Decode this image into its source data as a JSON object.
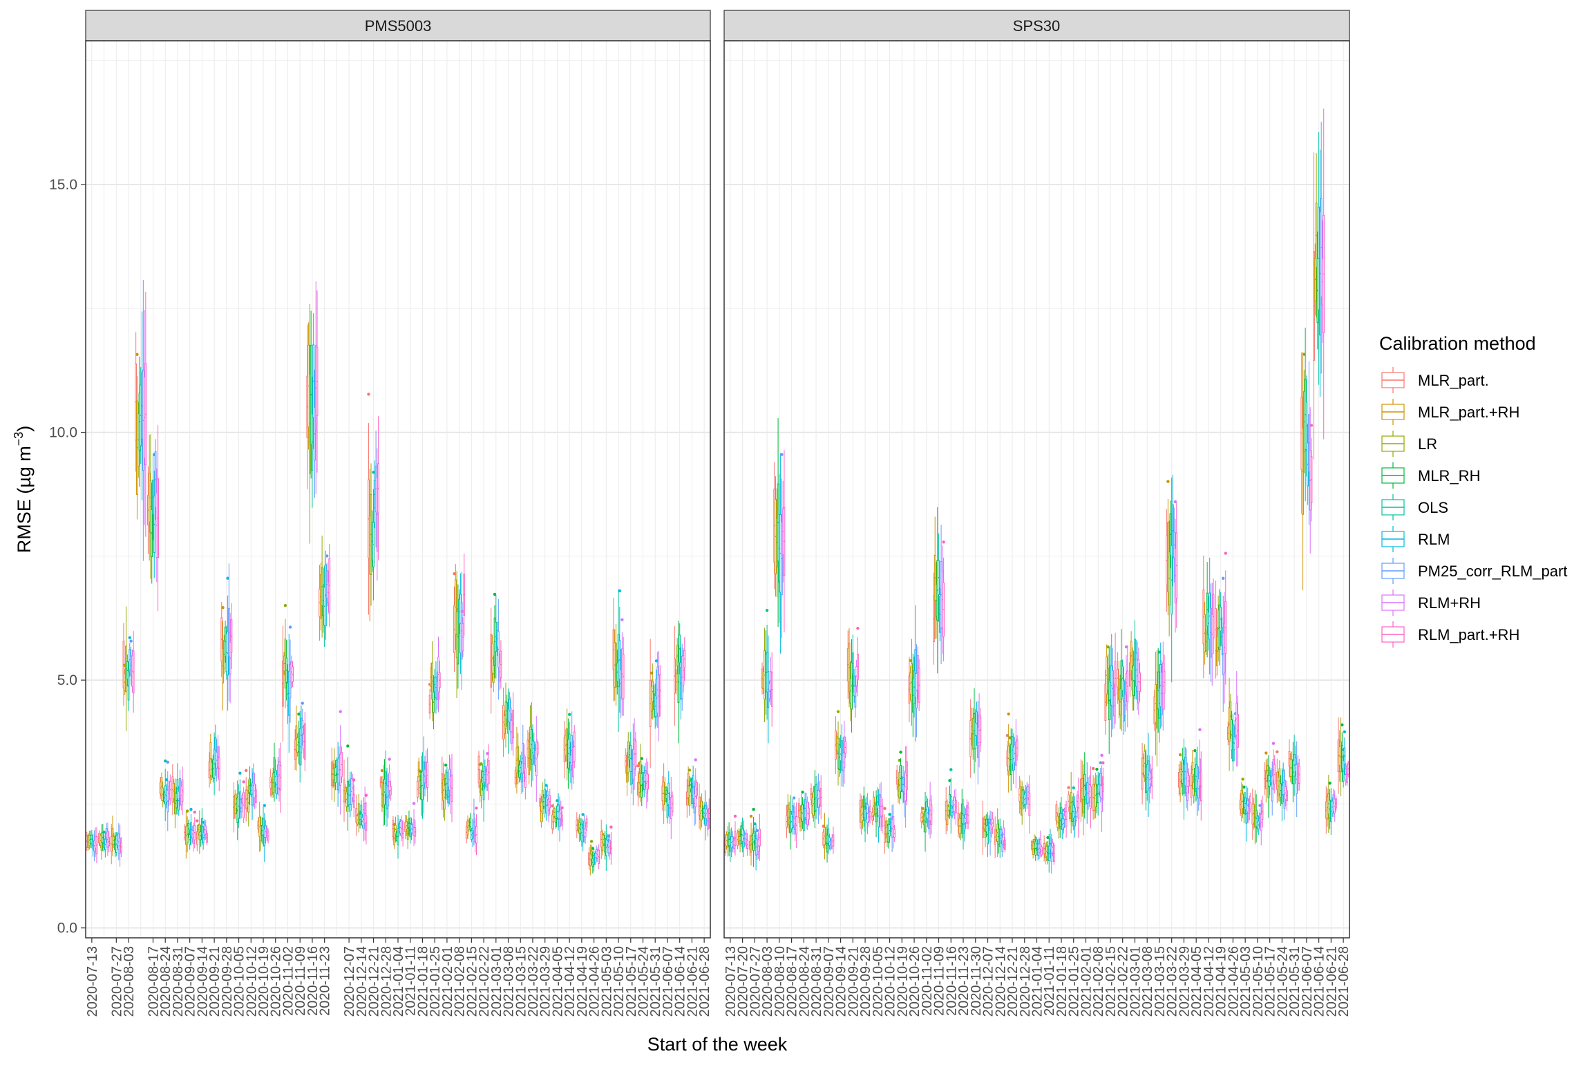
{
  "chart_data": {
    "type": "boxplot",
    "facets": [
      "PMS5003",
      "SPS30"
    ],
    "xlabel": "Start of the week",
    "ylabel": "RMSE (µg m",
    "ylabel_superscript": "−3",
    "ylabel_close": ")",
    "ylim": [
      -0.2,
      17.9
    ],
    "yticks": [
      0.0,
      5.0,
      10.0,
      15.0
    ],
    "ytick_labels": [
      "0.0",
      "5.0",
      "10.0",
      "15.0"
    ],
    "weeks": [
      "2020-07-13",
      "2020-07-20",
      "2020-07-27",
      "2020-08-03",
      "2020-08-10",
      "2020-08-17",
      "2020-08-24",
      "2020-08-31",
      "2020-09-07",
      "2020-09-14",
      "2020-09-21",
      "2020-09-28",
      "2020-10-05",
      "2020-10-12",
      "2020-10-19",
      "2020-10-26",
      "2020-11-02",
      "2020-11-09",
      "2020-11-16",
      "2020-11-23",
      "2020-11-30",
      "2020-12-07",
      "2020-12-14",
      "2020-12-21",
      "2020-12-28",
      "2021-01-04",
      "2021-01-11",
      "2021-01-18",
      "2021-01-25",
      "2021-02-01",
      "2021-02-08",
      "2021-02-15",
      "2021-02-22",
      "2021-03-01",
      "2021-03-08",
      "2021-03-15",
      "2021-03-22",
      "2021-03-29",
      "2021-04-05",
      "2021-04-12",
      "2021-04-19",
      "2021-04-26",
      "2021-05-03",
      "2021-05-10",
      "2021-05-17",
      "2021-05-24",
      "2021-05-31",
      "2021-06-07",
      "2021-06-14",
      "2021-06-21",
      "2021-06-28"
    ],
    "xtick_labels": {
      "PMS5003": [
        "2020-07-13",
        "2020-07-27",
        "2020-08-03",
        "2020-08-17",
        "2020-08-24",
        "2020-08-31",
        "2020-09-07",
        "2020-09-14",
        "2020-09-21",
        "2020-09-28",
        "2020-10-05",
        "2020-10-12",
        "2020-10-19",
        "2020-10-26",
        "2020-11-02",
        "2020-11-09",
        "2020-11-16",
        "2020-11-23",
        "2020-12-07",
        "2020-12-14",
        "2020-12-21",
        "2020-12-28",
        "2021-01-04",
        "2021-01-11",
        "2021-01-18",
        "2021-01-25",
        "2021-02-01",
        "2021-02-08",
        "2021-02-15",
        "2021-02-22",
        "2021-03-01",
        "2021-03-08",
        "2021-03-15",
        "2021-03-22",
        "2021-03-29",
        "2021-04-05",
        "2021-04-12",
        "2021-04-19",
        "2021-04-26",
        "2021-05-03",
        "2021-05-10",
        "2021-05-17",
        "2021-05-24",
        "2021-05-31",
        "2021-06-07",
        "2021-06-14",
        "2021-06-21",
        "2021-06-28"
      ],
      "SPS30": [
        "2020-07-13",
        "2020-07-20",
        "2020-07-27",
        "2020-08-03",
        "2020-08-10",
        "2020-08-17",
        "2020-08-24",
        "2020-08-31",
        "2020-09-07",
        "2020-09-14",
        "2020-09-21",
        "2020-09-28",
        "2020-10-05",
        "2020-10-12",
        "2020-10-19",
        "2020-10-26",
        "2020-11-02",
        "2020-11-09",
        "2020-11-16",
        "2020-11-23",
        "2020-11-30",
        "2020-12-07",
        "2020-12-14",
        "2020-12-21",
        "2020-12-28",
        "2021-01-04",
        "2021-01-11",
        "2021-01-18",
        "2021-01-25",
        "2021-02-01",
        "2021-02-08",
        "2021-02-15",
        "2021-02-22",
        "2021-03-01",
        "2021-03-08",
        "2021-03-15",
        "2021-03-22",
        "2021-03-29",
        "2021-04-05",
        "2021-04-12",
        "2021-04-19",
        "2021-04-26",
        "2021-05-03",
        "2021-05-10",
        "2021-05-17",
        "2021-05-24",
        "2021-05-31",
        "2021-06-07",
        "2021-06-14",
        "2021-06-21",
        "2021-06-28"
      ]
    },
    "legend": {
      "title": "Calibration method",
      "position": "right",
      "entries": [
        {
          "name": "MLR_part.",
          "color": "#F8766D"
        },
        {
          "name": "MLR_part.+RH",
          "color": "#D39200"
        },
        {
          "name": "LR",
          "color": "#93AA00"
        },
        {
          "name": "MLR_RH",
          "color": "#00BA38"
        },
        {
          "name": "OLS",
          "color": "#00C19F"
        },
        {
          "name": "RLM",
          "color": "#00B9E3"
        },
        {
          "name": "PM25_corr_RLM_part",
          "color": "#619CFF"
        },
        {
          "name": "RLM+RH",
          "color": "#DB72FB"
        },
        {
          "name": "RLM_part.+RH",
          "color": "#FF61C3"
        }
      ]
    },
    "weekly_rmse_median_approx": {
      "PMS5003": [
        1.75,
        1.8,
        1.75,
        5.2,
        10.3,
        8.5,
        2.7,
        2.65,
        1.9,
        1.95,
        3.4,
        5.6,
        2.55,
        2.7,
        1.95,
        3.0,
        5.0,
        3.8,
        10.5,
        6.5,
        3.2,
        2.7,
        2.2,
        8.3,
        2.8,
        1.9,
        2.0,
        3.0,
        4.8,
        2.8,
        6.3,
        2.0,
        3.0,
        5.5,
        4.2,
        3.2,
        3.6,
        2.5,
        2.2,
        3.5,
        2.0,
        1.4,
        1.7,
        5.3,
        3.3,
        3.0,
        4.8,
        2.6,
        5.3,
        2.7,
        2.3,
        3.1,
        6.7,
        5.2,
        8.3,
        4.6,
        8.5,
        10.8,
        4.4,
        6.8,
        4.8,
        8.3,
        3.1,
        6.7,
        6.2,
        8.2,
        5.1,
        4.7,
        2.3,
        2.9,
        3.0,
        3.3,
        3.9,
        4.5,
        9.0,
        12.4,
        11.9,
        2.6,
        3.4,
        3.6,
        4.5,
        3.4
      ],
      "SPS30": [
        1.7,
        1.8,
        1.75,
        5.0,
        8.0,
        2.2,
        2.3,
        2.6,
        1.8,
        3.5,
        5.0,
        2.3,
        2.4,
        2.0,
        2.9,
        5.0,
        2.3,
        6.7,
        2.4,
        2.2,
        4.0,
        2.0,
        1.8,
        3.5,
        2.6,
        1.6,
        1.6,
        2.2,
        2.4,
        2.7,
        2.8,
        4.8,
        4.8,
        5.3,
        3.2,
        4.7,
        7.5,
        3.0,
        3.0,
        6.2,
        5.9,
        4.0,
        2.4,
        2.2,
        3.0,
        2.8,
        3.2,
        9.7,
        13.3,
        2.5,
        3.3
      ]
    }
  }
}
